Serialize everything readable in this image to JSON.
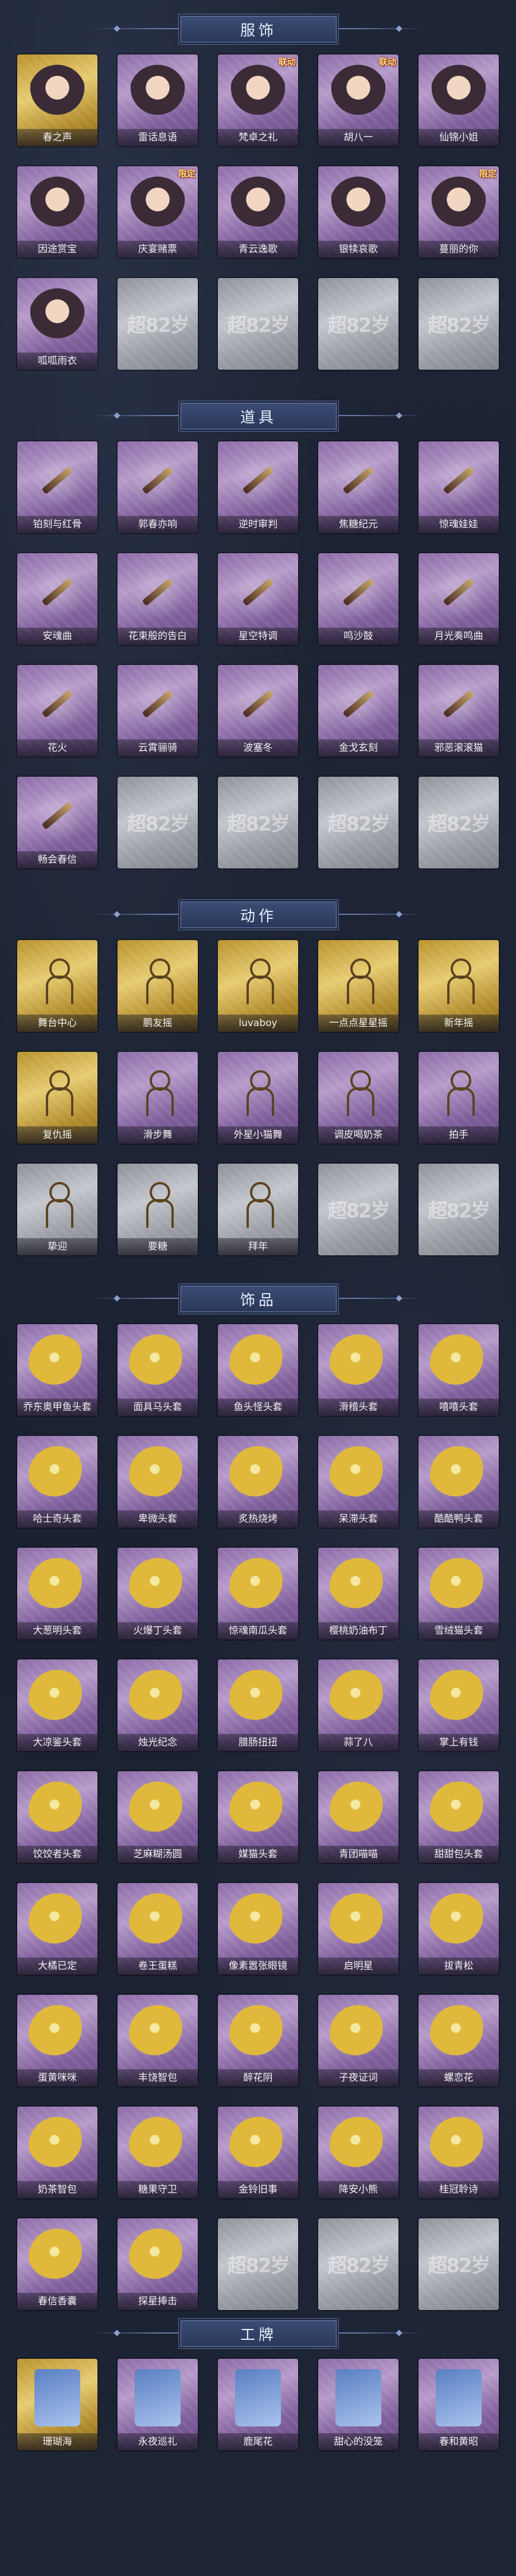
{
  "sections": [
    {
      "title": "服饰",
      "items": [
        {
          "label": "春之声",
          "style": "gold",
          "icon": "costume-icon",
          "badge": "",
          "locked": false
        },
        {
          "label": "雷话息语",
          "style": "purple",
          "icon": "costume-icon",
          "badge": "",
          "locked": false
        },
        {
          "label": "梵卓之礼",
          "style": "purple",
          "icon": "costume-icon",
          "badge": "联动",
          "locked": false
        },
        {
          "label": "胡八一",
          "style": "purple",
          "icon": "costume-icon",
          "badge": "联动",
          "locked": false
        },
        {
          "label": "仙锦小姐",
          "style": "purple",
          "icon": "costume-icon",
          "badge": "",
          "locked": false
        },
        {
          "label": "因途赏宝",
          "style": "purple",
          "icon": "costume-icon",
          "badge": "",
          "locked": false
        },
        {
          "label": "庆宴赌票",
          "style": "purple",
          "icon": "costume-icon",
          "badge": "限定",
          "locked": false
        },
        {
          "label": "青云逸歌",
          "style": "purple",
          "icon": "costume-icon",
          "badge": "",
          "locked": false
        },
        {
          "label": "银犊哀歌",
          "style": "purple",
          "icon": "costume-icon",
          "badge": "",
          "locked": false
        },
        {
          "label": "蔓丽的你",
          "style": "purple",
          "icon": "costume-icon",
          "badge": "限定",
          "locked": false
        },
        {
          "label": "呱呱雨衣",
          "style": "purple",
          "icon": "costume-icon",
          "badge": "",
          "locked": false
        },
        {
          "label": "",
          "style": "locked",
          "icon": "empty-slot-icon",
          "badge": "",
          "locked": true
        },
        {
          "label": "",
          "style": "locked",
          "icon": "empty-slot-icon",
          "badge": "",
          "locked": true
        },
        {
          "label": "",
          "style": "locked",
          "icon": "empty-slot-icon",
          "badge": "",
          "locked": true
        },
        {
          "label": "",
          "style": "locked",
          "icon": "empty-slot-icon",
          "badge": "",
          "locked": true
        }
      ]
    },
    {
      "title": "道具",
      "items": [
        {
          "label": "铂刻与红骨",
          "style": "purple",
          "icon": "prop-icon",
          "badge": "",
          "locked": false
        },
        {
          "label": "郭春亦响",
          "style": "purple",
          "icon": "prop-icon",
          "badge": "",
          "locked": false
        },
        {
          "label": "逆时审判",
          "style": "purple",
          "icon": "prop-icon",
          "badge": "",
          "locked": false
        },
        {
          "label": "焦糖纪元",
          "style": "purple",
          "icon": "prop-icon",
          "badge": "",
          "locked": false
        },
        {
          "label": "惊魂娃娃",
          "style": "purple",
          "icon": "prop-icon",
          "badge": "",
          "locked": false
        },
        {
          "label": "安魂曲",
          "style": "purple",
          "icon": "prop-icon",
          "badge": "",
          "locked": false
        },
        {
          "label": "花束般的告白",
          "style": "purple",
          "icon": "prop-icon",
          "badge": "",
          "locked": false
        },
        {
          "label": "星空特调",
          "style": "purple",
          "icon": "prop-icon",
          "badge": "",
          "locked": false
        },
        {
          "label": "鸣沙鼓",
          "style": "purple",
          "icon": "prop-icon",
          "badge": "",
          "locked": false
        },
        {
          "label": "月光奏鸣曲",
          "style": "purple",
          "icon": "prop-icon",
          "badge": "",
          "locked": false
        },
        {
          "label": "花火",
          "style": "purple",
          "icon": "prop-icon",
          "badge": "",
          "locked": false
        },
        {
          "label": "云霄骊骑",
          "style": "purple",
          "icon": "prop-icon",
          "badge": "",
          "locked": false
        },
        {
          "label": "波塞冬",
          "style": "purple",
          "icon": "prop-icon",
          "badge": "",
          "locked": false
        },
        {
          "label": "金戈玄刻",
          "style": "purple",
          "icon": "prop-icon",
          "badge": "",
          "locked": false
        },
        {
          "label": "邪恶滚滚猫",
          "style": "purple",
          "icon": "prop-icon",
          "badge": "",
          "locked": false
        },
        {
          "label": "畅会春信",
          "style": "purple",
          "icon": "prop-icon",
          "badge": "",
          "locked": false
        },
        {
          "label": "",
          "style": "locked",
          "icon": "empty-slot-icon",
          "badge": "",
          "locked": true
        },
        {
          "label": "",
          "style": "locked",
          "icon": "empty-slot-icon",
          "badge": "",
          "locked": true
        },
        {
          "label": "",
          "style": "locked",
          "icon": "empty-slot-icon",
          "badge": "",
          "locked": true
        },
        {
          "label": "",
          "style": "locked",
          "icon": "empty-slot-icon",
          "badge": "",
          "locked": true
        }
      ]
    },
    {
      "title": "动作",
      "items": [
        {
          "label": "舞台中心",
          "style": "gold",
          "icon": "pose-icon",
          "badge": "",
          "locked": false
        },
        {
          "label": "鹏友摇",
          "style": "gold",
          "icon": "pose-icon",
          "badge": "",
          "locked": false
        },
        {
          "label": "luvaboy",
          "style": "gold",
          "icon": "pose-icon",
          "badge": "",
          "locked": false
        },
        {
          "label": "一点点星星摇",
          "style": "gold",
          "icon": "pose-icon",
          "badge": "",
          "locked": false
        },
        {
          "label": "新年摇",
          "style": "gold",
          "icon": "pose-icon",
          "badge": "",
          "locked": false
        },
        {
          "label": "复仇摇",
          "style": "gold",
          "icon": "pose-icon",
          "badge": "",
          "locked": false
        },
        {
          "label": "滑步舞",
          "style": "purple",
          "icon": "pose-icon",
          "badge": "",
          "locked": false
        },
        {
          "label": "外星小猫舞",
          "style": "purple",
          "icon": "pose-icon",
          "badge": "",
          "locked": false
        },
        {
          "label": "调皮喝奶茶",
          "style": "purple",
          "icon": "pose-icon",
          "badge": "",
          "locked": false
        },
        {
          "label": "拍手",
          "style": "purple",
          "icon": "pose-icon",
          "badge": "",
          "locked": false
        },
        {
          "label": "挚迎",
          "style": "locked",
          "icon": "pose-icon",
          "badge": "",
          "locked": false
        },
        {
          "label": "要糖",
          "style": "locked",
          "icon": "pose-icon",
          "badge": "",
          "locked": false
        },
        {
          "label": "拜年",
          "style": "locked",
          "icon": "pose-icon",
          "badge": "",
          "locked": false
        },
        {
          "label": "",
          "style": "locked",
          "icon": "empty-slot-icon",
          "badge": "",
          "locked": true
        },
        {
          "label": "",
          "style": "locked",
          "icon": "empty-slot-icon",
          "badge": "",
          "locked": true
        }
      ]
    },
    {
      "title": "饰品",
      "items": [
        {
          "label": "乔东奥甲鱼头套",
          "style": "purple",
          "icon": "headgear-icon",
          "badge": "",
          "locked": false
        },
        {
          "label": "面具马头套",
          "style": "purple",
          "icon": "headgear-icon",
          "badge": "",
          "locked": false
        },
        {
          "label": "鱼头怪头套",
          "style": "purple",
          "icon": "headgear-icon",
          "badge": "",
          "locked": false
        },
        {
          "label": "滑稽头套",
          "style": "purple",
          "icon": "headgear-icon",
          "badge": "",
          "locked": false
        },
        {
          "label": "嘻嘻头套",
          "style": "purple",
          "icon": "headgear-icon",
          "badge": "",
          "locked": false
        },
        {
          "label": "哈士奇头套",
          "style": "purple",
          "icon": "headgear-icon",
          "badge": "",
          "locked": false
        },
        {
          "label": "卑微头套",
          "style": "purple",
          "icon": "headgear-icon",
          "badge": "",
          "locked": false
        },
        {
          "label": "炙热烧烤",
          "style": "purple",
          "icon": "headgear-icon",
          "badge": "",
          "locked": false
        },
        {
          "label": "呆滞头套",
          "style": "purple",
          "icon": "headgear-icon",
          "badge": "",
          "locked": false
        },
        {
          "label": "酷酷鸭头套",
          "style": "purple",
          "icon": "headgear-icon",
          "badge": "",
          "locked": false
        },
        {
          "label": "大葱明头套",
          "style": "purple",
          "icon": "headgear-icon",
          "badge": "",
          "locked": false
        },
        {
          "label": "火爆丁头套",
          "style": "purple",
          "icon": "headgear-icon",
          "badge": "",
          "locked": false
        },
        {
          "label": "惊魂南瓜头套",
          "style": "purple",
          "icon": "headgear-icon",
          "badge": "",
          "locked": false
        },
        {
          "label": "樱桃奶油布丁",
          "style": "purple",
          "icon": "headgear-icon",
          "badge": "",
          "locked": false
        },
        {
          "label": "雪绒猫头套",
          "style": "purple",
          "icon": "headgear-icon",
          "badge": "",
          "locked": false
        },
        {
          "label": "大凉鉴头套",
          "style": "purple",
          "icon": "headgear-icon",
          "badge": "",
          "locked": false
        },
        {
          "label": "烛光纪念",
          "style": "purple",
          "icon": "headgear-icon",
          "badge": "",
          "locked": false
        },
        {
          "label": "腊肠扭扭",
          "style": "purple",
          "icon": "headgear-icon",
          "badge": "",
          "locked": false
        },
        {
          "label": "蒜了八",
          "style": "purple",
          "icon": "headgear-icon",
          "badge": "",
          "locked": false
        },
        {
          "label": "掌上有钱",
          "style": "purple",
          "icon": "headgear-icon",
          "badge": "",
          "locked": false
        },
        {
          "label": "饺饺者头套",
          "style": "purple",
          "icon": "headgear-icon",
          "badge": "",
          "locked": false
        },
        {
          "label": "芝麻糊汤圆",
          "style": "purple",
          "icon": "headgear-icon",
          "badge": "",
          "locked": false
        },
        {
          "label": "媒猫头套",
          "style": "purple",
          "icon": "headgear-icon",
          "badge": "",
          "locked": false
        },
        {
          "label": "青团喵喵",
          "style": "purple",
          "icon": "headgear-icon",
          "badge": "",
          "locked": false
        },
        {
          "label": "甜甜包头套",
          "style": "purple",
          "icon": "headgear-icon",
          "badge": "",
          "locked": false
        },
        {
          "label": "大橘已定",
          "style": "purple",
          "icon": "headgear-icon",
          "badge": "",
          "locked": false
        },
        {
          "label": "卷王蛋糕",
          "style": "purple",
          "icon": "headgear-icon",
          "badge": "",
          "locked": false
        },
        {
          "label": "像素嚣张眼镜",
          "style": "purple",
          "icon": "headgear-icon",
          "badge": "",
          "locked": false
        },
        {
          "label": "启明星",
          "style": "purple",
          "icon": "headgear-icon",
          "badge": "",
          "locked": false
        },
        {
          "label": "拔青松",
          "style": "purple",
          "icon": "headgear-icon",
          "badge": "",
          "locked": false
        },
        {
          "label": "蛋黄咪咪",
          "style": "purple",
          "icon": "headgear-icon",
          "badge": "",
          "locked": false
        },
        {
          "label": "丰饶智包",
          "style": "purple",
          "icon": "headgear-icon",
          "badge": "",
          "locked": false
        },
        {
          "label": "醉花阴",
          "style": "purple",
          "icon": "headgear-icon",
          "badge": "",
          "locked": false
        },
        {
          "label": "子夜证词",
          "style": "purple",
          "icon": "headgear-icon",
          "badge": "",
          "locked": false
        },
        {
          "label": "螺恋花",
          "style": "purple",
          "icon": "headgear-icon",
          "badge": "",
          "locked": false
        },
        {
          "label": "奶茶智包",
          "style": "purple",
          "icon": "headgear-icon",
          "badge": "",
          "locked": false
        },
        {
          "label": "糖果守卫",
          "style": "purple",
          "icon": "headgear-icon",
          "badge": "",
          "locked": false
        },
        {
          "label": "金铃旧事",
          "style": "purple",
          "icon": "headgear-icon",
          "badge": "",
          "locked": false
        },
        {
          "label": "降安小熊",
          "style": "purple",
          "icon": "headgear-icon",
          "badge": "",
          "locked": false
        },
        {
          "label": "桂冠聆诗",
          "style": "purple",
          "icon": "headgear-icon",
          "badge": "",
          "locked": false
        },
        {
          "label": "春信香囊",
          "style": "purple",
          "icon": "headgear-icon",
          "badge": "",
          "locked": false
        },
        {
          "label": "探星捧击",
          "style": "purple",
          "icon": "headgear-icon",
          "badge": "",
          "locked": false
        },
        {
          "label": "",
          "style": "locked",
          "icon": "empty-slot-icon",
          "badge": "",
          "locked": true
        },
        {
          "label": "",
          "style": "locked",
          "icon": "empty-slot-icon",
          "badge": "",
          "locked": true
        },
        {
          "label": "",
          "style": "locked",
          "icon": "empty-slot-icon",
          "badge": "",
          "locked": true
        }
      ]
    },
    {
      "title": "工牌",
      "items": [
        {
          "label": "珊瑚海",
          "style": "gold",
          "icon": "badge-card-icon",
          "badge": "",
          "locked": false
        },
        {
          "label": "永夜巡礼",
          "style": "purple",
          "icon": "badge-card-icon",
          "badge": "",
          "locked": false
        },
        {
          "label": "鹿尾花",
          "style": "purple",
          "icon": "badge-card-icon",
          "badge": "",
          "locked": false
        },
        {
          "label": "甜心的没笼",
          "style": "purple",
          "icon": "badge-card-icon",
          "badge": "",
          "locked": false
        },
        {
          "label": "春和黄昭",
          "style": "purple",
          "icon": "badge-card-icon",
          "badge": "",
          "locked": false
        }
      ]
    }
  ],
  "watermark_text": "超82岁",
  "colors": {
    "gold": "#e7cb70",
    "purple": "#b69ac9",
    "locked": "#c3c6cc",
    "banner": "#3b4c74"
  }
}
